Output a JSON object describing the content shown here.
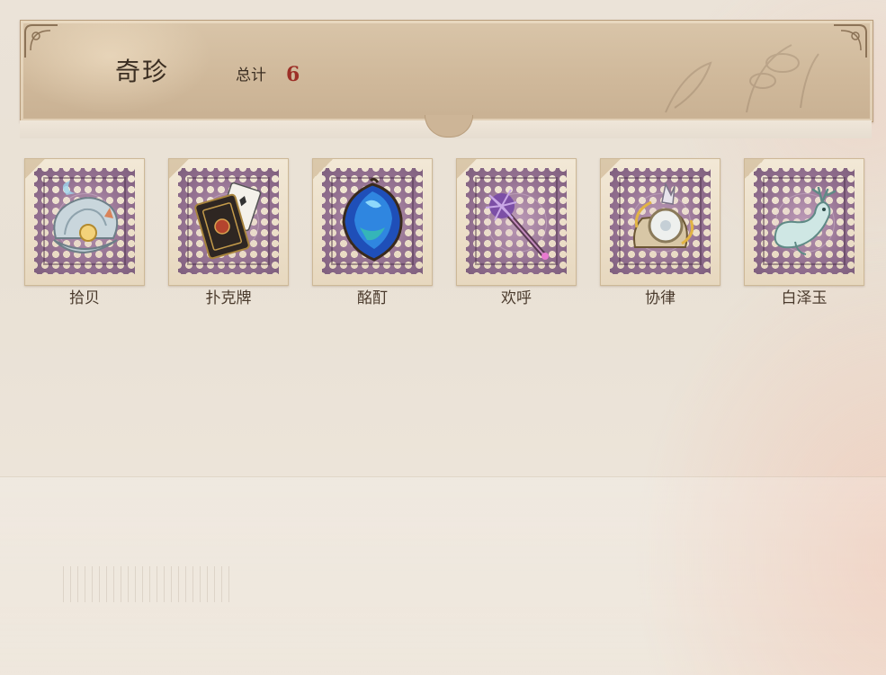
{
  "header": {
    "title": "奇珍",
    "total_label": "总计",
    "total_value": "6"
  },
  "items": [
    {
      "label": "拾贝",
      "icon": "pearl-shell-icon"
    },
    {
      "label": "扑克牌",
      "icon": "playing-cards-icon"
    },
    {
      "label": "酩酊",
      "icon": "blue-crystal-heart-icon"
    },
    {
      "label": "欢呼",
      "icon": "purple-pompom-staff-icon"
    },
    {
      "label": "协律",
      "icon": "golden-clockwork-icon"
    },
    {
      "label": "白泽玉",
      "icon": "jade-deer-icon"
    }
  ],
  "colors": {
    "stamp": "#9a7796",
    "accent_number": "#9c2f27",
    "banner": "#d0b99b"
  }
}
